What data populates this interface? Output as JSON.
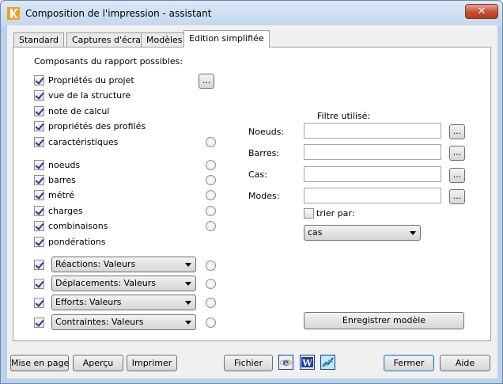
{
  "window": {
    "title": "Composition de l'impression - assistant",
    "close_label": "✕",
    "accent_color": "#c8502f"
  },
  "tabs": [
    {
      "label": "Standard",
      "active": false
    },
    {
      "label": "Captures d'écran",
      "active": false
    },
    {
      "label": "Modèles",
      "active": false
    },
    {
      "label": "Edition simplifiée",
      "active": true
    }
  ],
  "components": {
    "heading": "Composants du rapport possibles:",
    "more_label": "...",
    "items": [
      {
        "label": "Propriétés du projet",
        "checked": true
      },
      {
        "label": "vue de la structure",
        "checked": true
      },
      {
        "label": "note de calcul",
        "checked": true
      },
      {
        "label": "propriétés des profilés",
        "checked": true
      },
      {
        "label": "caractéristiques",
        "checked": true
      },
      {
        "label": "noeuds",
        "checked": true
      },
      {
        "label": "barres",
        "checked": true
      },
      {
        "label": "métré",
        "checked": true
      },
      {
        "label": "charges",
        "checked": true
      },
      {
        "label": "combinaisons",
        "checked": true
      },
      {
        "label": "pondérations",
        "checked": true
      }
    ],
    "dropdowns": [
      {
        "value": "Réactions: Valeurs",
        "checked": true
      },
      {
        "value": "Déplacements: Valeurs",
        "checked": true
      },
      {
        "value": "Efforts: Valeurs",
        "checked": true
      },
      {
        "value": "Contraintes: Valeurs",
        "checked": true
      }
    ]
  },
  "filter": {
    "heading": "Filtre utilisé:",
    "browse_label": "...",
    "fields": [
      {
        "label": "Noeuds:",
        "value": ""
      },
      {
        "label": "Barres:",
        "value": ""
      },
      {
        "label": "Cas:",
        "value": ""
      },
      {
        "label": "Modes:",
        "value": ""
      }
    ],
    "sort_label": "trier par:",
    "sort_checked": false,
    "sort_value": "cas",
    "save_model_label": "Enregistrer modèle"
  },
  "footer": {
    "page_setup": "Mise en page",
    "preview": "Aperçu",
    "print": "Imprimer",
    "file": "Fichier",
    "icons": [
      "ie-export-icon",
      "word-export-icon",
      "chart-export-icon"
    ],
    "close": "Fermer",
    "help": "Aide"
  }
}
